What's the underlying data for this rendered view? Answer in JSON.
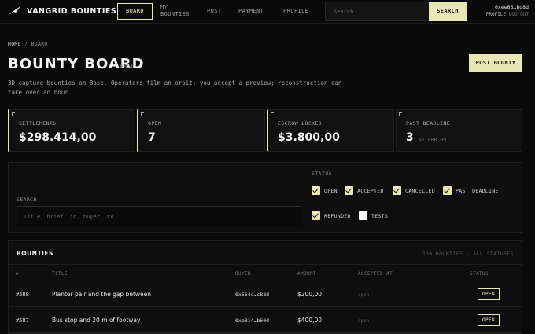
{
  "brand": {
    "name": "VANGRID BOUNTIES",
    "logo_icon": "bird-icon"
  },
  "nav": {
    "board": "BOARD",
    "my_bounties_line1": "MY",
    "my_bounties_line2": "BOUNTIES",
    "post": "POST",
    "payment": "PAYMENT",
    "profile": "PROFILE"
  },
  "search": {
    "placeholder": "Search…",
    "button": "SEARCH"
  },
  "wallet": {
    "address": "0xee66…bd8d",
    "profile": "PROFILE",
    "logout": "LOG OUT"
  },
  "breadcrumb": {
    "home": "HOME",
    "separator": "/",
    "current": "BOARD"
  },
  "page": {
    "title": "BOUNTY BOARD",
    "network": "BASE",
    "post_button": "POST BOUNTY",
    "description": "3D capture bounties on Base. Operators film an orbit; you accept a preview; reconstruction can take over an hour."
  },
  "stats": [
    {
      "label": "SETTLEMENTS",
      "value": "$298.414,00",
      "sub": ""
    },
    {
      "label": "OPEN",
      "value": "7",
      "sub": ""
    },
    {
      "label": "ESCROW LOCKED",
      "value": "$3.800,00",
      "sub": ""
    },
    {
      "label": "PAST DEADLINE",
      "value": "3",
      "sub": "$1.000,00"
    }
  ],
  "filters": {
    "search_label": "SEARCH",
    "search_placeholder": "Title, brief, id, buyer, tx…",
    "status_label": "STATUS",
    "statuses": [
      {
        "label": "OPEN",
        "checked": true
      },
      {
        "label": "ACCEPTED",
        "checked": true
      },
      {
        "label": "CANCELLED",
        "checked": true
      },
      {
        "label": "PAST DEADLINE",
        "checked": true
      },
      {
        "label": "REFUNDED",
        "checked": true
      },
      {
        "label": "TESTS",
        "checked": false
      }
    ]
  },
  "table": {
    "title": "BOUNTIES",
    "count": "300 BOUNTIES · ALL STATUSES",
    "headers": [
      "#",
      "TITLE",
      "BUYER",
      "AMOUNT",
      "ACCEPTED AT",
      "STATUS"
    ],
    "rows": [
      {
        "id": "#588",
        "title": "Planter pair and the gap between",
        "buyer": "0x564c…c88d",
        "amount": "$200,00",
        "accepted_at": "open",
        "status": "OPEN"
      },
      {
        "id": "#587",
        "title": "Bus stop and 20 m of footway",
        "buyer": "0xe814…b60d",
        "amount": "$400,00",
        "accepted_at": "open",
        "status": "OPEN"
      }
    ]
  },
  "colors": {
    "accent": "#e9e8b4",
    "background": "#0a0a0a",
    "panel": "#111111"
  }
}
